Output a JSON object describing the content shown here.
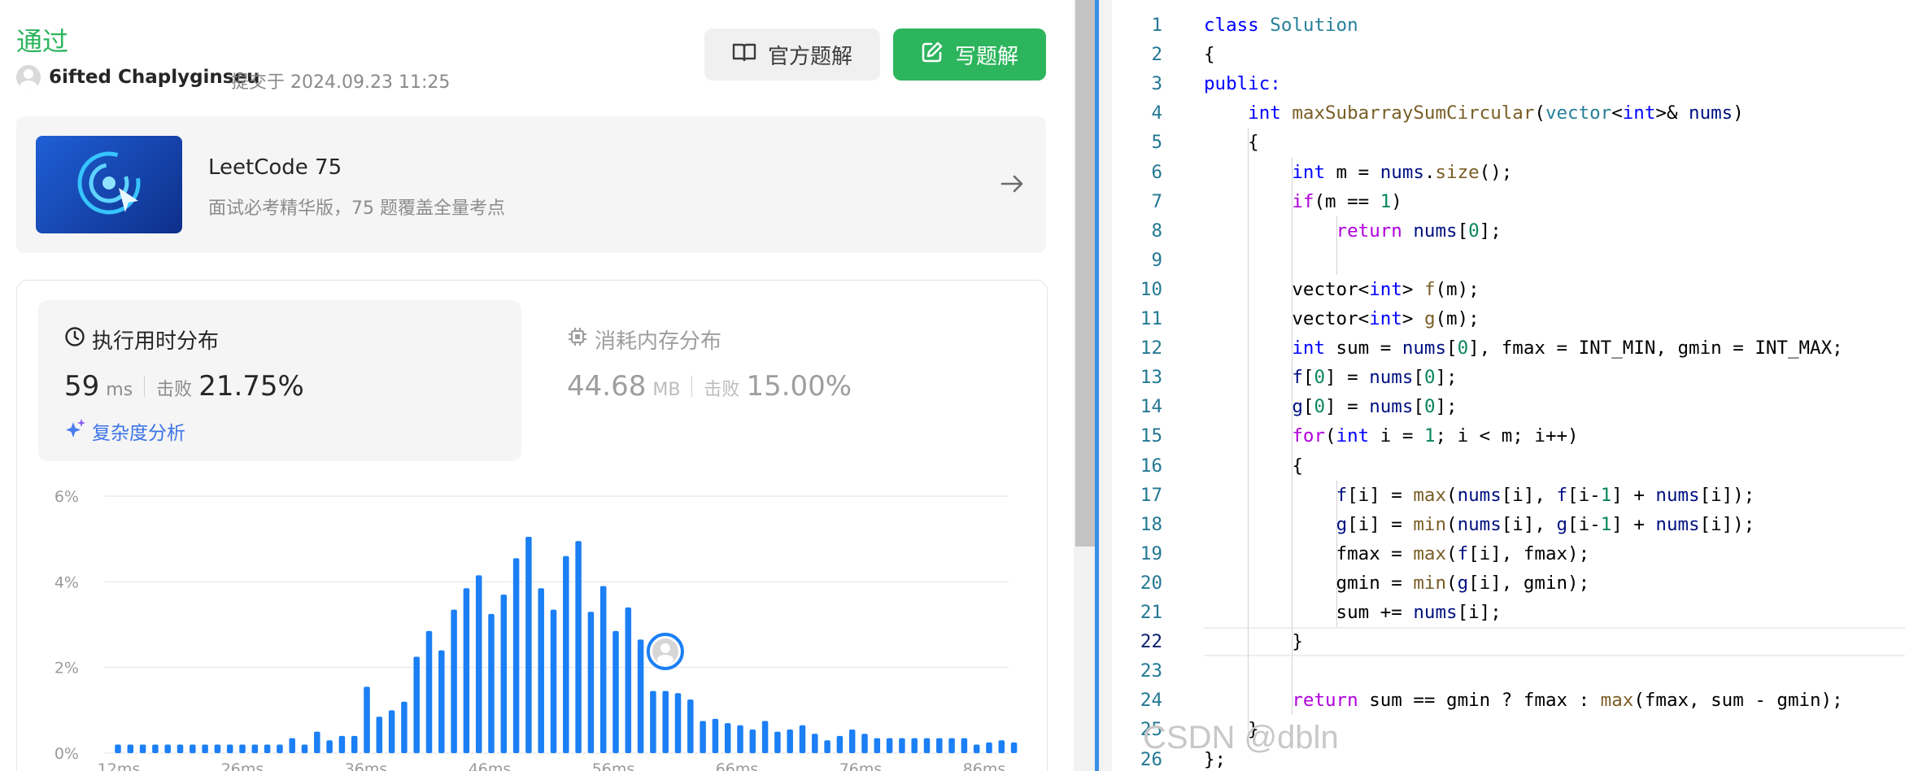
{
  "submission": {
    "status": "通过",
    "username": "6ifted Chaplyginseu",
    "submitted_meta": "提交于 2024.09.23 11:25",
    "official_solution_label": "官方题解",
    "write_solution_label": "写题解"
  },
  "promo": {
    "title": "LeetCode 75",
    "subtitle": "面试必考精华版，75 题覆盖全量考点"
  },
  "runtime": {
    "title": "执行用时分布",
    "value": "59",
    "unit": "ms",
    "beat_label": "击败",
    "beat_value": "21.75%",
    "complexity_link": "复杂度分析"
  },
  "memory": {
    "title": "消耗内存分布",
    "value": "44.68",
    "unit": "MB",
    "beat_label": "击败",
    "beat_value": "15.00%"
  },
  "chart_data": {
    "type": "bar",
    "y_ticks": [
      "6%",
      "4%",
      "2%",
      "0%"
    ],
    "x_ticks": [
      "12ms",
      "26ms",
      "36ms",
      "46ms",
      "56ms",
      "66ms",
      "76ms",
      "86ms"
    ],
    "ylim": [
      0,
      6
    ],
    "grid": true,
    "user_marker_bar_index": 43,
    "values": [
      0.2,
      0.2,
      0.2,
      0.2,
      0.2,
      0.2,
      0.2,
      0.2,
      0.2,
      0.2,
      0.2,
      0.2,
      0.2,
      0.2,
      0.35,
      0.2,
      0.5,
      0.3,
      0.4,
      0.4,
      1.55,
      0.85,
      1.0,
      1.2,
      2.25,
      2.85,
      2.4,
      3.35,
      3.85,
      4.15,
      3.25,
      3.7,
      4.55,
      5.05,
      3.85,
      3.35,
      4.6,
      4.95,
      3.3,
      3.9,
      2.85,
      3.4,
      2.65,
      1.45,
      1.45,
      1.4,
      1.25,
      0.75,
      0.8,
      0.7,
      0.65,
      0.55,
      0.75,
      0.5,
      0.55,
      0.65,
      0.45,
      0.3,
      0.4,
      0.55,
      0.45,
      0.35,
      0.35,
      0.35,
      0.35,
      0.35,
      0.35,
      0.35,
      0.35,
      0.2,
      0.25,
      0.3,
      0.25
    ]
  },
  "editor": {
    "current_line": 22,
    "lines": [
      [
        [
          "kw",
          "class"
        ],
        [
          "pl",
          " "
        ],
        [
          "type",
          "Solution"
        ]
      ],
      [
        [
          "pl",
          "{"
        ]
      ],
      [
        [
          "kw",
          "public:"
        ]
      ],
      [
        [
          "pl",
          "    "
        ],
        [
          "kw",
          "int"
        ],
        [
          "pl",
          " "
        ],
        [
          "fn",
          "maxSubarraySumCircular"
        ],
        [
          "pl",
          "("
        ],
        [
          "type",
          "vector"
        ],
        [
          "pl",
          "<"
        ],
        [
          "kw",
          "int"
        ],
        [
          "pl",
          ">& "
        ],
        [
          "var",
          "nums"
        ],
        [
          "pl",
          ")"
        ]
      ],
      [
        [
          "pl",
          "    {"
        ]
      ],
      [
        [
          "pl",
          "        "
        ],
        [
          "kw",
          "int"
        ],
        [
          "pl",
          " m = "
        ],
        [
          "var",
          "nums"
        ],
        [
          "pl",
          "."
        ],
        [
          "fn",
          "size"
        ],
        [
          "pl",
          "();"
        ]
      ],
      [
        [
          "pl",
          "        "
        ],
        [
          "ctl",
          "if"
        ],
        [
          "pl",
          "(m == "
        ],
        [
          "num",
          "1"
        ],
        [
          "pl",
          ")"
        ]
      ],
      [
        [
          "pl",
          "            "
        ],
        [
          "ctl",
          "return"
        ],
        [
          "pl",
          " "
        ],
        [
          "var",
          "nums"
        ],
        [
          "pl",
          "["
        ],
        [
          "num",
          "0"
        ],
        [
          "pl",
          "];"
        ]
      ],
      [
        [
          "pl",
          ""
        ]
      ],
      [
        [
          "pl",
          "        vector<"
        ],
        [
          "kw",
          "int"
        ],
        [
          "pl",
          "> "
        ],
        [
          "fn",
          "f"
        ],
        [
          "pl",
          "(m);"
        ]
      ],
      [
        [
          "pl",
          "        vector<"
        ],
        [
          "kw",
          "int"
        ],
        [
          "pl",
          "> "
        ],
        [
          "fn",
          "g"
        ],
        [
          "pl",
          "(m);"
        ]
      ],
      [
        [
          "pl",
          "        "
        ],
        [
          "kw",
          "int"
        ],
        [
          "pl",
          " sum = "
        ],
        [
          "var",
          "nums"
        ],
        [
          "pl",
          "["
        ],
        [
          "num",
          "0"
        ],
        [
          "pl",
          "], fmax = INT_MIN, gmin = INT_MAX;"
        ]
      ],
      [
        [
          "pl",
          "        "
        ],
        [
          "var",
          "f"
        ],
        [
          "pl",
          "["
        ],
        [
          "num",
          "0"
        ],
        [
          "pl",
          "] = "
        ],
        [
          "var",
          "nums"
        ],
        [
          "pl",
          "["
        ],
        [
          "num",
          "0"
        ],
        [
          "pl",
          "];"
        ]
      ],
      [
        [
          "pl",
          "        "
        ],
        [
          "var",
          "g"
        ],
        [
          "pl",
          "["
        ],
        [
          "num",
          "0"
        ],
        [
          "pl",
          "] = "
        ],
        [
          "var",
          "nums"
        ],
        [
          "pl",
          "["
        ],
        [
          "num",
          "0"
        ],
        [
          "pl",
          "];"
        ]
      ],
      [
        [
          "pl",
          "        "
        ],
        [
          "ctl",
          "for"
        ],
        [
          "pl",
          "("
        ],
        [
          "kw",
          "int"
        ],
        [
          "pl",
          " i = "
        ],
        [
          "num",
          "1"
        ],
        [
          "pl",
          "; i < m; i++)"
        ]
      ],
      [
        [
          "pl",
          "        {"
        ]
      ],
      [
        [
          "pl",
          "            "
        ],
        [
          "var",
          "f"
        ],
        [
          "pl",
          "[i] = "
        ],
        [
          "fn",
          "max"
        ],
        [
          "pl",
          "("
        ],
        [
          "var",
          "nums"
        ],
        [
          "pl",
          "[i], "
        ],
        [
          "var",
          "f"
        ],
        [
          "pl",
          "[i-"
        ],
        [
          "num",
          "1"
        ],
        [
          "pl",
          "] + "
        ],
        [
          "var",
          "nums"
        ],
        [
          "pl",
          "[i]);"
        ]
      ],
      [
        [
          "pl",
          "            "
        ],
        [
          "var",
          "g"
        ],
        [
          "pl",
          "[i] = "
        ],
        [
          "fn",
          "min"
        ],
        [
          "pl",
          "("
        ],
        [
          "var",
          "nums"
        ],
        [
          "pl",
          "[i], "
        ],
        [
          "var",
          "g"
        ],
        [
          "pl",
          "[i-"
        ],
        [
          "num",
          "1"
        ],
        [
          "pl",
          "] + "
        ],
        [
          "var",
          "nums"
        ],
        [
          "pl",
          "[i]);"
        ]
      ],
      [
        [
          "pl",
          "            fmax = "
        ],
        [
          "fn",
          "max"
        ],
        [
          "pl",
          "("
        ],
        [
          "var",
          "f"
        ],
        [
          "pl",
          "[i], fmax);"
        ]
      ],
      [
        [
          "pl",
          "            gmin = "
        ],
        [
          "fn",
          "min"
        ],
        [
          "pl",
          "("
        ],
        [
          "var",
          "g"
        ],
        [
          "pl",
          "[i], gmin);"
        ]
      ],
      [
        [
          "pl",
          "            sum += "
        ],
        [
          "var",
          "nums"
        ],
        [
          "pl",
          "[i];"
        ]
      ],
      [
        [
          "pl",
          "        }"
        ]
      ],
      [
        [
          "pl",
          ""
        ]
      ],
      [
        [
          "pl",
          "        "
        ],
        [
          "ctl",
          "return"
        ],
        [
          "pl",
          " sum == gmin ? fmax : "
        ],
        [
          "fn",
          "max"
        ],
        [
          "pl",
          "(fmax, sum - gmin);"
        ]
      ],
      [
        [
          "pl",
          "    }"
        ]
      ],
      [
        [
          "pl",
          "};"
        ]
      ]
    ]
  },
  "watermark": "CSDN @dbln"
}
